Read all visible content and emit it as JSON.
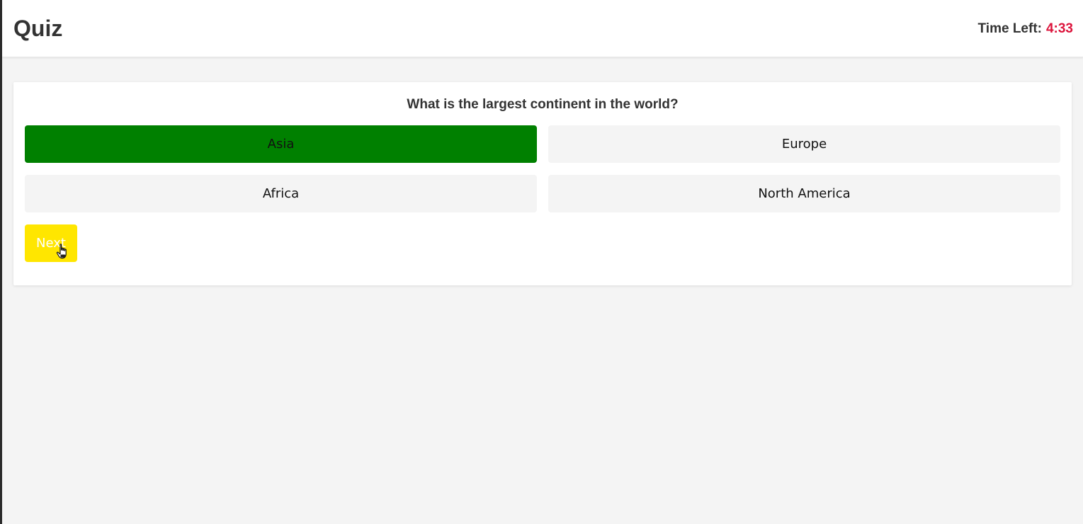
{
  "header": {
    "title": "Quiz",
    "timer_label": "Time Left:",
    "timer_value": "4:33"
  },
  "quiz": {
    "question": "What is the largest continent in the world?",
    "options": [
      {
        "label": "Asia",
        "state": "correct"
      },
      {
        "label": "Europe",
        "state": "default"
      },
      {
        "label": "Africa",
        "state": "default"
      },
      {
        "label": "North America",
        "state": "default"
      }
    ],
    "next_label": "Next"
  },
  "colors": {
    "correct": "#008000",
    "next_button": "#ffe600",
    "timer_value": "#dc143c",
    "option_default": "#f4f4f4"
  },
  "icons": {
    "cursor": "hand-pointer-icon"
  }
}
